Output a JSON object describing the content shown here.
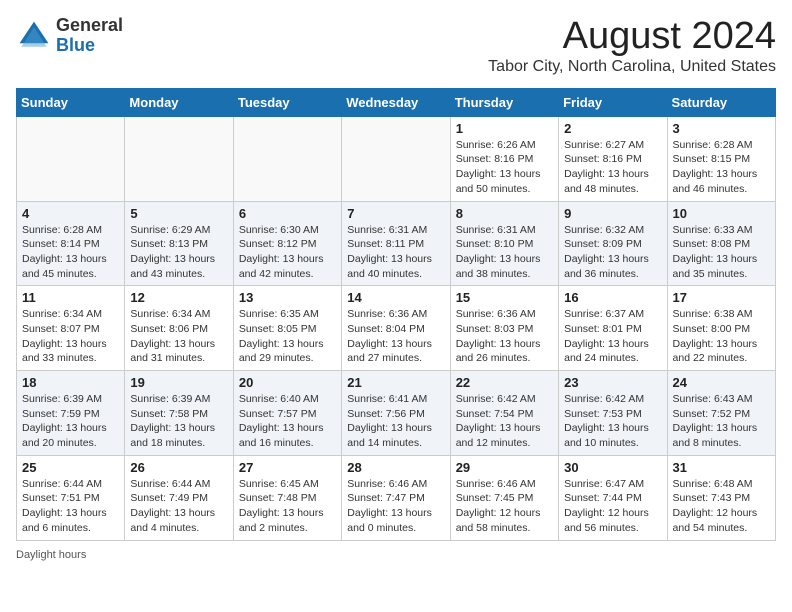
{
  "header": {
    "logo_line1": "General",
    "logo_line2": "Blue",
    "month_title": "August 2024",
    "location": "Tabor City, North Carolina, United States"
  },
  "days_of_week": [
    "Sunday",
    "Monday",
    "Tuesday",
    "Wednesday",
    "Thursday",
    "Friday",
    "Saturday"
  ],
  "weeks": [
    [
      {
        "day": "",
        "info": ""
      },
      {
        "day": "",
        "info": ""
      },
      {
        "day": "",
        "info": ""
      },
      {
        "day": "",
        "info": ""
      },
      {
        "day": "1",
        "info": "Sunrise: 6:26 AM\nSunset: 8:16 PM\nDaylight: 13 hours\nand 50 minutes."
      },
      {
        "day": "2",
        "info": "Sunrise: 6:27 AM\nSunset: 8:16 PM\nDaylight: 13 hours\nand 48 minutes."
      },
      {
        "day": "3",
        "info": "Sunrise: 6:28 AM\nSunset: 8:15 PM\nDaylight: 13 hours\nand 46 minutes."
      }
    ],
    [
      {
        "day": "4",
        "info": "Sunrise: 6:28 AM\nSunset: 8:14 PM\nDaylight: 13 hours\nand 45 minutes."
      },
      {
        "day": "5",
        "info": "Sunrise: 6:29 AM\nSunset: 8:13 PM\nDaylight: 13 hours\nand 43 minutes."
      },
      {
        "day": "6",
        "info": "Sunrise: 6:30 AM\nSunset: 8:12 PM\nDaylight: 13 hours\nand 42 minutes."
      },
      {
        "day": "7",
        "info": "Sunrise: 6:31 AM\nSunset: 8:11 PM\nDaylight: 13 hours\nand 40 minutes."
      },
      {
        "day": "8",
        "info": "Sunrise: 6:31 AM\nSunset: 8:10 PM\nDaylight: 13 hours\nand 38 minutes."
      },
      {
        "day": "9",
        "info": "Sunrise: 6:32 AM\nSunset: 8:09 PM\nDaylight: 13 hours\nand 36 minutes."
      },
      {
        "day": "10",
        "info": "Sunrise: 6:33 AM\nSunset: 8:08 PM\nDaylight: 13 hours\nand 35 minutes."
      }
    ],
    [
      {
        "day": "11",
        "info": "Sunrise: 6:34 AM\nSunset: 8:07 PM\nDaylight: 13 hours\nand 33 minutes."
      },
      {
        "day": "12",
        "info": "Sunrise: 6:34 AM\nSunset: 8:06 PM\nDaylight: 13 hours\nand 31 minutes."
      },
      {
        "day": "13",
        "info": "Sunrise: 6:35 AM\nSunset: 8:05 PM\nDaylight: 13 hours\nand 29 minutes."
      },
      {
        "day": "14",
        "info": "Sunrise: 6:36 AM\nSunset: 8:04 PM\nDaylight: 13 hours\nand 27 minutes."
      },
      {
        "day": "15",
        "info": "Sunrise: 6:36 AM\nSunset: 8:03 PM\nDaylight: 13 hours\nand 26 minutes."
      },
      {
        "day": "16",
        "info": "Sunrise: 6:37 AM\nSunset: 8:01 PM\nDaylight: 13 hours\nand 24 minutes."
      },
      {
        "day": "17",
        "info": "Sunrise: 6:38 AM\nSunset: 8:00 PM\nDaylight: 13 hours\nand 22 minutes."
      }
    ],
    [
      {
        "day": "18",
        "info": "Sunrise: 6:39 AM\nSunset: 7:59 PM\nDaylight: 13 hours\nand 20 minutes."
      },
      {
        "day": "19",
        "info": "Sunrise: 6:39 AM\nSunset: 7:58 PM\nDaylight: 13 hours\nand 18 minutes."
      },
      {
        "day": "20",
        "info": "Sunrise: 6:40 AM\nSunset: 7:57 PM\nDaylight: 13 hours\nand 16 minutes."
      },
      {
        "day": "21",
        "info": "Sunrise: 6:41 AM\nSunset: 7:56 PM\nDaylight: 13 hours\nand 14 minutes."
      },
      {
        "day": "22",
        "info": "Sunrise: 6:42 AM\nSunset: 7:54 PM\nDaylight: 13 hours\nand 12 minutes."
      },
      {
        "day": "23",
        "info": "Sunrise: 6:42 AM\nSunset: 7:53 PM\nDaylight: 13 hours\nand 10 minutes."
      },
      {
        "day": "24",
        "info": "Sunrise: 6:43 AM\nSunset: 7:52 PM\nDaylight: 13 hours\nand 8 minutes."
      }
    ],
    [
      {
        "day": "25",
        "info": "Sunrise: 6:44 AM\nSunset: 7:51 PM\nDaylight: 13 hours\nand 6 minutes."
      },
      {
        "day": "26",
        "info": "Sunrise: 6:44 AM\nSunset: 7:49 PM\nDaylight: 13 hours\nand 4 minutes."
      },
      {
        "day": "27",
        "info": "Sunrise: 6:45 AM\nSunset: 7:48 PM\nDaylight: 13 hours\nand 2 minutes."
      },
      {
        "day": "28",
        "info": "Sunrise: 6:46 AM\nSunset: 7:47 PM\nDaylight: 13 hours\nand 0 minutes."
      },
      {
        "day": "29",
        "info": "Sunrise: 6:46 AM\nSunset: 7:45 PM\nDaylight: 12 hours\nand 58 minutes."
      },
      {
        "day": "30",
        "info": "Sunrise: 6:47 AM\nSunset: 7:44 PM\nDaylight: 12 hours\nand 56 minutes."
      },
      {
        "day": "31",
        "info": "Sunrise: 6:48 AM\nSunset: 7:43 PM\nDaylight: 12 hours\nand 54 minutes."
      }
    ]
  ],
  "footer": {
    "daylight_label": "Daylight hours"
  }
}
